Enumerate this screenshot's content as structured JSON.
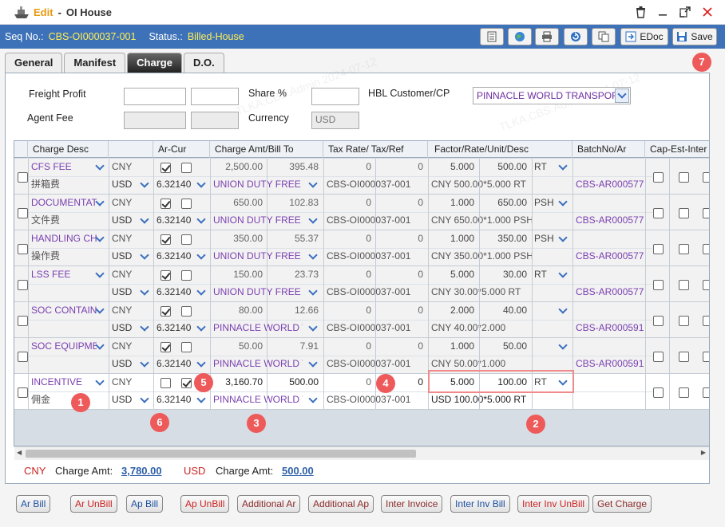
{
  "window": {
    "mode": "Edit",
    "separator": "-",
    "title": "OI House"
  },
  "info": {
    "seq_label": "Seq No.:",
    "seq_value": "CBS-OI000037-001",
    "status_label": "Status.:",
    "status_value": "Billed-House"
  },
  "toolbar": {
    "edoc": "EDoc",
    "save": "Save"
  },
  "tabs": [
    "General",
    "Manifest",
    "Charge",
    "D.O."
  ],
  "form": {
    "freight_profit": "Freight Profit",
    "share": "Share %",
    "hbl_customer": "HBL Customer/CP",
    "hbl_value": "PINNACLE WORLD TRANSPORT",
    "agent_fee": "Agent Fee",
    "currency": "Currency",
    "currency_value": "USD"
  },
  "headers": [
    "Charge Desc",
    "",
    "Ar-Cur",
    "Charge Amt/Bill To",
    "Tax Rate/ Tax/Ref",
    "Factor/Rate/Unit/Desc",
    "BatchNo/Ar",
    "Cap-Est-Inter"
  ],
  "rows": [
    {
      "desc": "CFS FEE",
      "desc2": "拼箱费",
      "cur1": "CNY",
      "cur2": "USD",
      "rate": "6.32140",
      "ar": true,
      "ap": false,
      "amt": "2,500.00",
      "amt2": "395.48",
      "bill": "UNION DUTY FREE",
      "tax": "0",
      "tax2": "0",
      "ref": "CBS-OI000037-001",
      "factor": "5.000",
      "frate": "500.00",
      "unit": "RT",
      "desc3": "CNY 500.00*5.000 RT",
      "batch": "CBS-AR000577"
    },
    {
      "desc": "DOCUMENTATION",
      "desc2": "文件费",
      "cur1": "CNY",
      "cur2": "USD",
      "rate": "6.32140",
      "ar": true,
      "ap": false,
      "amt": "650.00",
      "amt2": "102.83",
      "bill": "UNION DUTY FREE",
      "tax": "0",
      "tax2": "0",
      "ref": "CBS-OI000037-001",
      "factor": "1.000",
      "frate": "650.00",
      "unit": "PSH",
      "desc3": "CNY 650.00*1.000 PSH",
      "batch": "CBS-AR000577"
    },
    {
      "desc": "HANDLING CHARGE",
      "desc2": "操作费",
      "cur1": "CNY",
      "cur2": "USD",
      "rate": "6.32140",
      "ar": true,
      "ap": false,
      "amt": "350.00",
      "amt2": "55.37",
      "bill": "UNION DUTY FREE",
      "tax": "0",
      "tax2": "0",
      "ref": "CBS-OI000037-001",
      "factor": "1.000",
      "frate": "350.00",
      "unit": "PSH",
      "desc3": "CNY 350.00*1.000 PSH",
      "batch": "CBS-AR000577"
    },
    {
      "desc": "LSS FEE",
      "desc2": "",
      "cur1": "CNY",
      "cur2": "USD",
      "rate": "6.32140",
      "ar": true,
      "ap": false,
      "amt": "150.00",
      "amt2": "23.73",
      "bill": "UNION DUTY FREE",
      "tax": "0",
      "tax2": "0",
      "ref": "CBS-OI000037-001",
      "factor": "5.000",
      "frate": "30.00",
      "unit": "RT",
      "desc3": "CNY 30.00*5.000 RT",
      "batch": "CBS-AR000577"
    },
    {
      "desc": "SOC CONTAINER",
      "desc2": "",
      "cur1": "CNY",
      "cur2": "USD",
      "rate": "6.32140",
      "ar": true,
      "ap": false,
      "amt": "80.00",
      "amt2": "12.66",
      "bill": "PINNACLE WORLD TRANSPORT",
      "tax": "0",
      "tax2": "0",
      "ref": "CBS-OI000037-001",
      "factor": "2.000",
      "frate": "40.00",
      "unit": "",
      "desc3": "CNY 40.00*2.000",
      "batch": "CBS-AR000591"
    },
    {
      "desc": "SOC EQUIPMENT",
      "desc2": "",
      "cur1": "CNY",
      "cur2": "USD",
      "rate": "6.32140",
      "ar": true,
      "ap": false,
      "amt": "50.00",
      "amt2": "7.91",
      "bill": "PINNACLE WORLD TRANSPORT",
      "tax": "0",
      "tax2": "0",
      "ref": "CBS-OI000037-001",
      "factor": "1.000",
      "frate": "50.00",
      "unit": "",
      "desc3": "CNY 50.00*1.000",
      "batch": "CBS-AR000591"
    },
    {
      "desc": "INCENTIVE",
      "desc2": "佣金",
      "cur1": "CNY",
      "cur2": "USD",
      "rate": "6.32140",
      "ar": false,
      "ap": true,
      "amt": "3,160.70",
      "amt2": "500.00",
      "bill": "PINNACLE WORLD TRANSPORT",
      "tax": "0",
      "tax2": "0",
      "ref": "CBS-OI000037-001",
      "factor": "5.000",
      "frate": "100.00",
      "unit": "RT",
      "desc3": "USD 100.00*5.000 RT",
      "batch": ""
    }
  ],
  "totals": {
    "cur1": "CNY",
    "label1": "Charge Amt:",
    "amt1": "3,780.00",
    "cur2": "USD",
    "label2": "Charge Amt:",
    "amt2": "500.00"
  },
  "actions": [
    "Ar Bill",
    "Ar UnBill",
    "Ap Bill",
    "Ap UnBill",
    "Additional Ar",
    "Additional Ap",
    "Inter Invoice",
    "Inter Inv Bill",
    "Inter Inv UnBill",
    "Get Charge"
  ],
  "badges": [
    "1",
    "2",
    "3",
    "4",
    "5",
    "6",
    "7"
  ],
  "watermark": "TLKA.CBS.Admin 2024-07-12"
}
